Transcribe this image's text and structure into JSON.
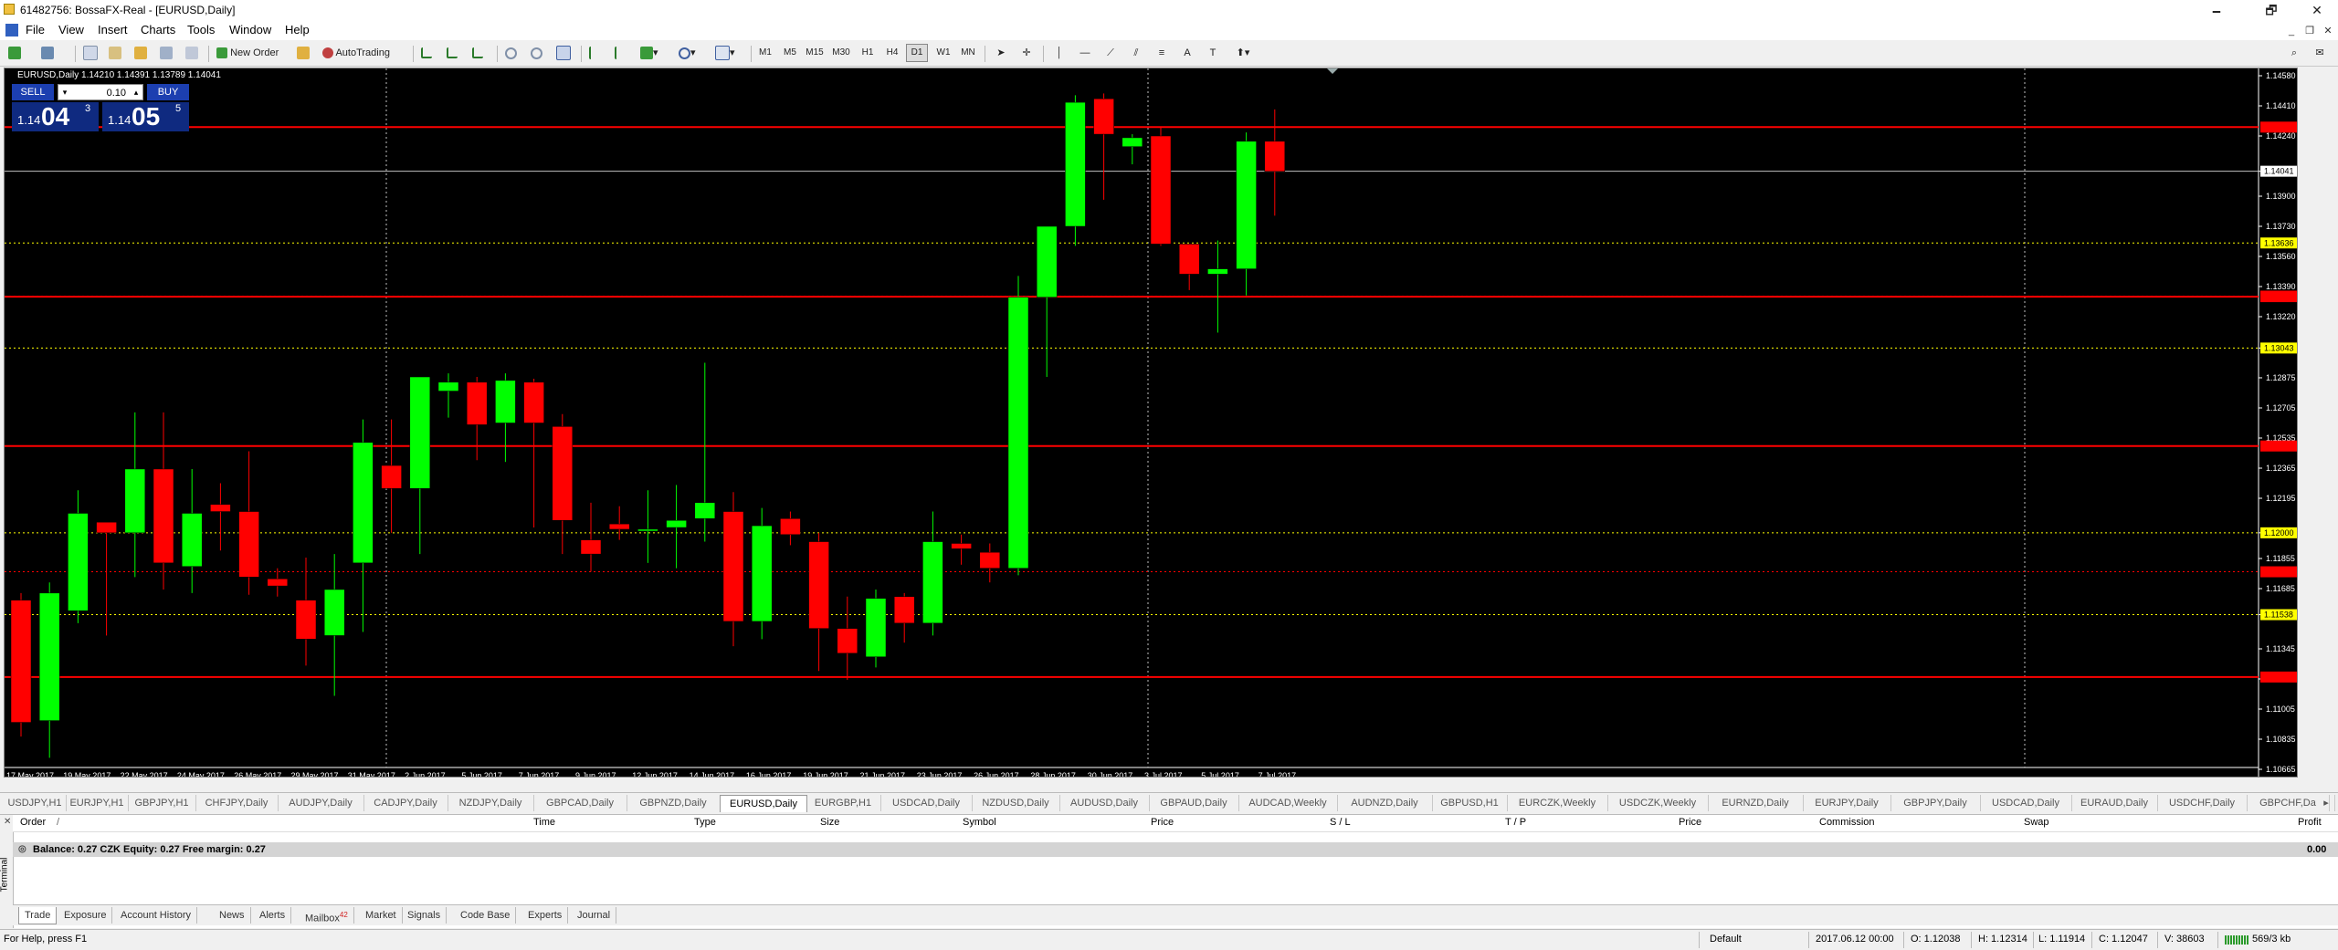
{
  "window": {
    "title": "61482756: BossaFX-Real - [EURUSD,Daily]",
    "minimize": "🗕",
    "maximize": "🗗",
    "close": "✕"
  },
  "menu": [
    "File",
    "View",
    "Insert",
    "Charts",
    "Tools",
    "Window",
    "Help"
  ],
  "toolbar": {
    "new_order": "New Order",
    "autotrading": "AutoTrading",
    "timeframes": [
      "M1",
      "M5",
      "M15",
      "M30",
      "H1",
      "H4",
      "D1",
      "W1",
      "MN"
    ]
  },
  "chart": {
    "symbol_info": "EURUSD,Daily  1.14210 1.14391 1.13789 1.14041",
    "trade": {
      "sell_label": "SELL",
      "buy_label": "BUY",
      "lot": "0.10",
      "bid_small": "1.14",
      "bid_big": "04",
      "bid_pip": "3",
      "ask_small": "1.14",
      "ask_big": "05",
      "ask_pip": "5"
    },
    "colors": {
      "background": "#000000",
      "bull": "#00ff00",
      "bear": "#ff0000",
      "hline": "#ff0000",
      "level": "#ffff00",
      "text": "#ffffff"
    }
  },
  "chart_data": {
    "type": "candlestick",
    "symbol": "EURUSD",
    "timeframe": "Daily",
    "ylim": [
      1.10665,
      1.1458
    ],
    "y_ticks": [
      "1.14580",
      "1.14410",
      "1.14240",
      "1.14041",
      "1.13900",
      "1.13730",
      "1.13560",
      "1.13390",
      "1.13220",
      "1.13043",
      "1.12875",
      "1.12705",
      "1.12535",
      "1.12365",
      "1.12195",
      "1.12000",
      "1.11855",
      "1.11685",
      "1.11538",
      "1.11345",
      "1.11175",
      "1.11005",
      "1.10835",
      "1.10665"
    ],
    "x_labels": [
      "17 May 2017",
      "19 May 2017",
      "22 May 2017",
      "24 May 2017",
      "26 May 2017",
      "29 May 2017",
      "31 May 2017",
      "2 Jun 2017",
      "5 Jun 2017",
      "7 Jun 2017",
      "9 Jun 2017",
      "12 Jun 2017",
      "14 Jun 2017",
      "16 Jun 2017",
      "19 Jun 2017",
      "21 Jun 2017",
      "23 Jun 2017",
      "26 Jun 2017",
      "28 Jun 2017",
      "30 Jun 2017",
      "3 Jul 2017",
      "5 Jul 2017",
      "7 Jul 2017"
    ],
    "candles": [
      {
        "o": 1.1162,
        "h": 1.1166,
        "l": 1.1085,
        "c": 1.1093
      },
      {
        "o": 1.1094,
        "h": 1.1172,
        "l": 1.1073,
        "c": 1.1166
      },
      {
        "o": 1.1156,
        "h": 1.1224,
        "l": 1.1149,
        "c": 1.1211
      },
      {
        "o": 1.1206,
        "h": 1.1205,
        "l": 1.1142,
        "c": 1.12
      },
      {
        "o": 1.12,
        "h": 1.1268,
        "l": 1.1175,
        "c": 1.1236
      },
      {
        "o": 1.1236,
        "h": 1.1268,
        "l": 1.1168,
        "c": 1.1183
      },
      {
        "o": 1.1181,
        "h": 1.1236,
        "l": 1.1166,
        "c": 1.1211
      },
      {
        "o": 1.1216,
        "h": 1.1228,
        "l": 1.119,
        "c": 1.1212
      },
      {
        "o": 1.1212,
        "h": 1.1246,
        "l": 1.1165,
        "c": 1.1175
      },
      {
        "o": 1.1174,
        "h": 1.118,
        "l": 1.1164,
        "c": 1.117
      },
      {
        "o": 1.1162,
        "h": 1.1186,
        "l": 1.1125,
        "c": 1.114
      },
      {
        "o": 1.1142,
        "h": 1.1188,
        "l": 1.1108,
        "c": 1.1168
      },
      {
        "o": 1.1183,
        "h": 1.1264,
        "l": 1.1144,
        "c": 1.1251
      },
      {
        "o": 1.1238,
        "h": 1.1264,
        "l": 1.12,
        "c": 1.1225
      },
      {
        "o": 1.1225,
        "h": 1.1279,
        "l": 1.1188,
        "c": 1.1288
      },
      {
        "o": 1.128,
        "h": 1.129,
        "l": 1.1265,
        "c": 1.1285
      },
      {
        "o": 1.1285,
        "h": 1.1288,
        "l": 1.1241,
        "c": 1.1261
      },
      {
        "o": 1.1262,
        "h": 1.129,
        "l": 1.124,
        "c": 1.1286
      },
      {
        "o": 1.1285,
        "h": 1.1287,
        "l": 1.1203,
        "c": 1.1262
      },
      {
        "o": 1.126,
        "h": 1.1267,
        "l": 1.1188,
        "c": 1.1207
      },
      {
        "o": 1.1196,
        "h": 1.1217,
        "l": 1.1178,
        "c": 1.1188
      },
      {
        "o": 1.1205,
        "h": 1.1215,
        "l": 1.1196,
        "c": 1.1202
      },
      {
        "o": 1.1202,
        "h": 1.1224,
        "l": 1.1183,
        "c": 1.1202
      },
      {
        "o": 1.1203,
        "h": 1.1227,
        "l": 1.118,
        "c": 1.1207
      },
      {
        "o": 1.1208,
        "h": 1.1296,
        "l": 1.1195,
        "c": 1.1217
      },
      {
        "o": 1.1212,
        "h": 1.1223,
        "l": 1.1136,
        "c": 1.115
      },
      {
        "o": 1.115,
        "h": 1.1214,
        "l": 1.114,
        "c": 1.1204
      },
      {
        "o": 1.1208,
        "h": 1.1212,
        "l": 1.1193,
        "c": 1.1199
      },
      {
        "o": 1.1195,
        "h": 1.12,
        "l": 1.1122,
        "c": 1.1146
      },
      {
        "o": 1.1146,
        "h": 1.1164,
        "l": 1.1117,
        "c": 1.1132
      },
      {
        "o": 1.113,
        "h": 1.1168,
        "l": 1.1124,
        "c": 1.1163
      },
      {
        "o": 1.1164,
        "h": 1.1166,
        "l": 1.1138,
        "c": 1.1149
      },
      {
        "o": 1.1149,
        "h": 1.1212,
        "l": 1.1142,
        "c": 1.1195
      },
      {
        "o": 1.1194,
        "h": 1.1199,
        "l": 1.1182,
        "c": 1.1191
      },
      {
        "o": 1.1189,
        "h": 1.1194,
        "l": 1.1172,
        "c": 1.118
      },
      {
        "o": 1.118,
        "h": 1.1345,
        "l": 1.1176,
        "c": 1.1333
      },
      {
        "o": 1.1333,
        "h": 1.1373,
        "l": 1.1288,
        "c": 1.1373
      },
      {
        "o": 1.1373,
        "h": 1.1447,
        "l": 1.1362,
        "c": 1.1443
      },
      {
        "o": 1.1445,
        "h": 1.1448,
        "l": 1.1388,
        "c": 1.1425
      },
      {
        "o": 1.1418,
        "h": 1.1425,
        "l": 1.1408,
        "c": 1.1423
      },
      {
        "o": 1.1424,
        "h": 1.1429,
        "l": 1.1362,
        "c": 1.1363
      },
      {
        "o": 1.1363,
        "h": 1.1363,
        "l": 1.1337,
        "c": 1.1346
      },
      {
        "o": 1.1346,
        "h": 1.1365,
        "l": 1.1313,
        "c": 1.1349
      },
      {
        "o": 1.1349,
        "h": 1.1426,
        "l": 1.1334,
        "c": 1.1421
      },
      {
        "o": 1.1421,
        "h": 1.1439,
        "l": 1.1379,
        "c": 1.1404
      }
    ],
    "hlines_red": [
      1.1429,
      1.13333,
      1.1249,
      1.11186
    ],
    "hlines_red_dotted": [
      1.13336,
      1.1178
    ],
    "hlines_yellow_dotted": [
      1.13636,
      1.13043,
      1.12,
      1.11538
    ],
    "level_labels": [
      {
        "value": 1.14041,
        "text": "1.14041",
        "style": "white"
      },
      {
        "value": 1.13636,
        "text": "1.13636",
        "style": "yellow"
      },
      {
        "value": 1.13043,
        "text": "1.13043",
        "style": "yellow"
      },
      {
        "value": 1.12,
        "text": "1.12000",
        "style": "yellow"
      },
      {
        "value": 1.11538,
        "text": "1.11538",
        "style": "yellow"
      }
    ],
    "current_price": 1.14041,
    "grid": false
  },
  "chart_tabs": [
    "USDJPY,H1",
    "EURJPY,H1",
    "GBPJPY,H1",
    "CHFJPY,Daily",
    "AUDJPY,Daily",
    "CADJPY,Daily",
    "NZDJPY,Daily",
    "GBPCAD,Daily",
    "GBPNZD,Daily",
    "EURUSD,Daily",
    "EURGBP,H1",
    "USDCAD,Daily",
    "NZDUSD,Daily",
    "AUDUSD,Daily",
    "GBPAUD,Daily",
    "AUDCAD,Weekly",
    "AUDNZD,Daily",
    "GBPUSD,H1",
    "EURCZK,Weekly",
    "USDCZK,Weekly",
    "EURNZD,Daily",
    "EURJPY,Daily",
    "GBPJPY,Daily",
    "USDCAD,Daily",
    "EURAUD,Daily",
    "USDCHF,Daily",
    "GBPCHF,Da"
  ],
  "active_chart_tab": 9,
  "terminal": {
    "side_label": "Terminal",
    "columns": [
      "Order",
      "Time",
      "Type",
      "Size",
      "Symbol",
      "Price",
      "S / L",
      "T / P",
      "Price",
      "Commission",
      "Swap",
      "Profit"
    ],
    "sort_marker": "/",
    "balance_text": "Balance: 0.27 CZK  Equity: 0.27  Free margin: 0.27",
    "profit_total": "0.00",
    "tabs": [
      "Trade",
      "Exposure",
      "Account History",
      "News",
      "Alerts",
      "Mailbox",
      "Market",
      "Signals",
      "Code Base",
      "Experts",
      "Journal"
    ],
    "mailbox_count": "42",
    "active_tab": 0
  },
  "status": {
    "help": "For Help, press F1",
    "profile": "Default",
    "datetime": "2017.06.12 00:00",
    "open": "O: 1.12038",
    "high": "H: 1.12314",
    "low": "L: 1.11914",
    "close": "C: 1.12047",
    "volume": "V: 38603",
    "traffic": "569/3 kb"
  }
}
